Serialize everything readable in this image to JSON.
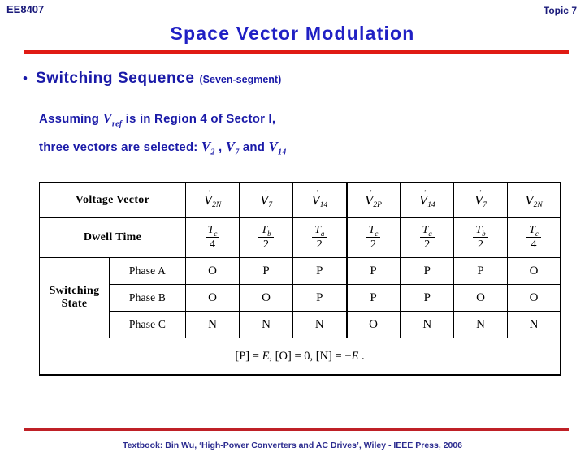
{
  "header": {
    "course_code": "EE8407",
    "topic": "Topic 7",
    "title": "Space Vector Modulation",
    "accent_red": "#e01b14",
    "accent_blue": "#2020c4",
    "text_navy": "#1a1aa8"
  },
  "bullet": {
    "marker": "•",
    "text": "Switching Sequence",
    "qualifier": "(Seven-segment)"
  },
  "paragraph": {
    "line1_before": "Assuming ",
    "line1_symbol": "V",
    "line1_symbol_sub": "ref",
    "line1_after": " is in Region 4 of Sector I,",
    "line2_before": "three vectors are selected:  ",
    "line2_v1": "V",
    "line2_v1_sub": "2",
    "line2_sep1": " , ",
    "line2_v2": "V",
    "line2_v2_sub": "7",
    "line2_sep2": " and ",
    "line2_v3": "V",
    "line2_v3_sub": "14"
  },
  "table": {
    "row_labels": {
      "voltage_vector": "Voltage Vector",
      "dwell_time": "Dwell Time",
      "switching_state": "Switching State",
      "phase_a": "Phase A",
      "phase_b": "Phase B",
      "phase_c": "Phase C"
    },
    "phase_letters": {
      "a": "A",
      "b": "B",
      "c": "C"
    },
    "voltage_vectors": [
      {
        "symbol": "V",
        "sub": "2N",
        "arrow": "→"
      },
      {
        "symbol": "V",
        "sub": "7",
        "arrow": "→"
      },
      {
        "symbol": "V",
        "sub": "14",
        "arrow": "→"
      },
      {
        "symbol": "V",
        "sub": "2P",
        "arrow": "→"
      },
      {
        "symbol": "V",
        "sub": "14",
        "arrow": "→"
      },
      {
        "symbol": "V",
        "sub": "7",
        "arrow": "→"
      },
      {
        "symbol": "V",
        "sub": "2N",
        "arrow": "→"
      }
    ],
    "dwell_times": [
      {
        "num": "T",
        "num_sub": "c",
        "den": "4"
      },
      {
        "num": "T",
        "num_sub": "b",
        "den": "2"
      },
      {
        "num": "T",
        "num_sub": "a",
        "den": "2"
      },
      {
        "num": "T",
        "num_sub": "c",
        "den": "2"
      },
      {
        "num": "T",
        "num_sub": "a",
        "den": "2"
      },
      {
        "num": "T",
        "num_sub": "b",
        "den": "2"
      },
      {
        "num": "T",
        "num_sub": "c",
        "den": "4"
      }
    ],
    "switching_state": {
      "phase_a": [
        "O",
        "P",
        "P",
        "P",
        "P",
        "P",
        "O"
      ],
      "phase_b": [
        "O",
        "O",
        "P",
        "P",
        "P",
        "O",
        "O"
      ],
      "phase_c": [
        "N",
        "N",
        "N",
        "O",
        "N",
        "N",
        "N"
      ]
    },
    "note": {
      "p_label": "[P]",
      "p_eq": " = ",
      "p_val": "E",
      "comma1": ",  ",
      "o_label": "[O]",
      "o_eq": " = ",
      "o_val": "0",
      "comma2": ",  ",
      "n_label": "[N]",
      "n_eq": " = −",
      "n_val": "E",
      "period": " ."
    }
  },
  "footer": {
    "text": "Textbook: Bin Wu, ‘High-Power Converters and AC Drives’, Wiley - IEEE Press, 2006"
  }
}
